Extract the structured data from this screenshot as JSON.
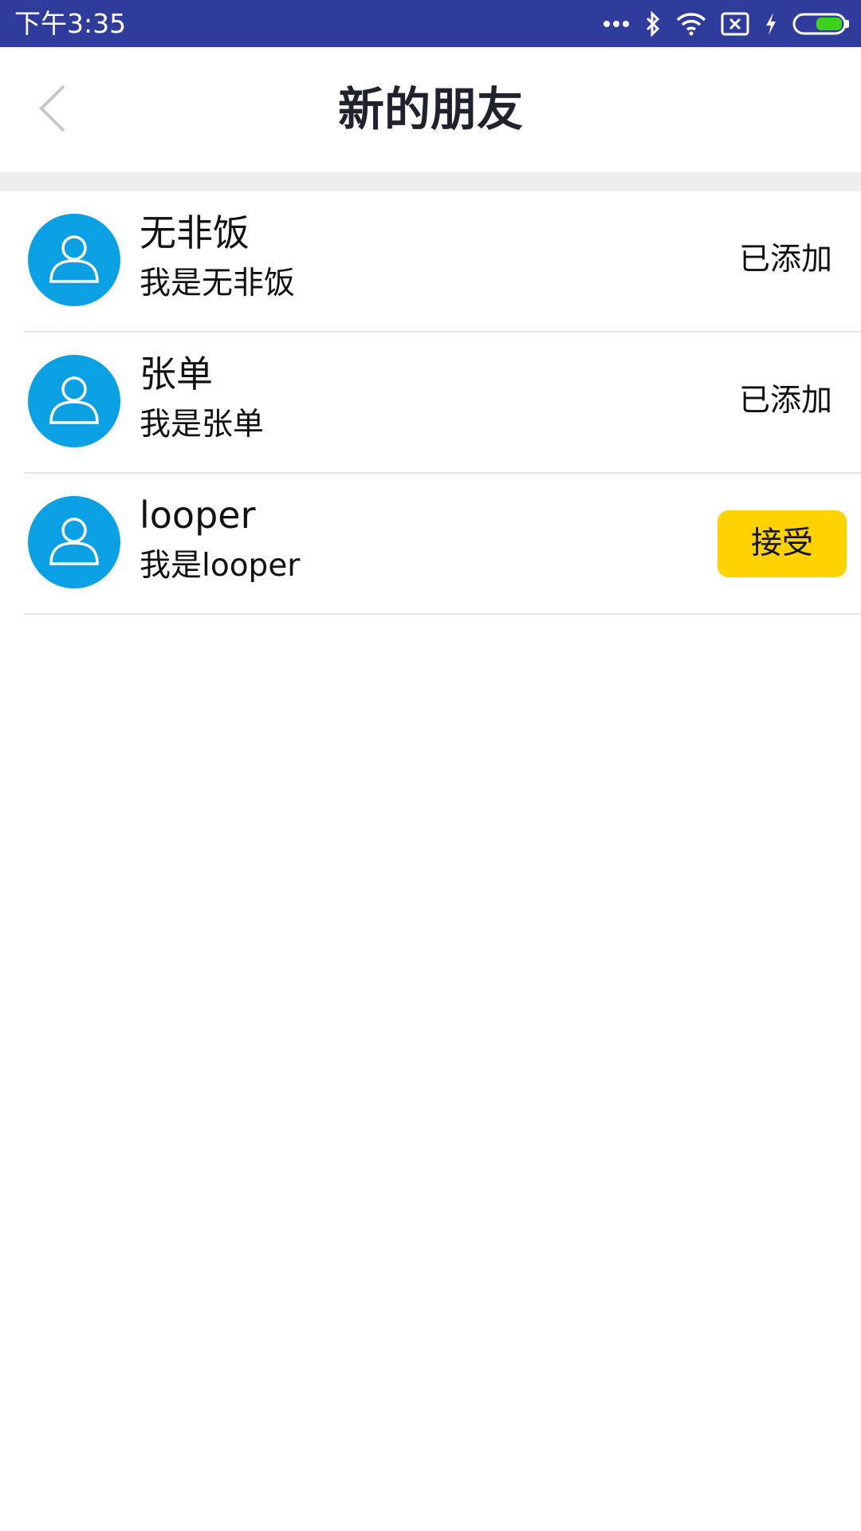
{
  "status_bar": {
    "time": "下午3:35",
    "icons": [
      "more-dots-icon",
      "bluetooth-icon",
      "wifi-icon",
      "no-sim-icon",
      "charging-icon",
      "battery-icon"
    ],
    "background": "#303c9b"
  },
  "header": {
    "title": "新的朋友",
    "back_icon": "chevron-left-icon"
  },
  "friends": [
    {
      "name": "无非饭",
      "message": "我是无非饭",
      "status": "已添加",
      "state": "added"
    },
    {
      "name": "张单",
      "message": "我是张单",
      "status": "已添加",
      "state": "added"
    },
    {
      "name": "looper",
      "message": "我是looper",
      "action": "接受",
      "state": "pending"
    }
  ],
  "colors": {
    "avatar": "#0aa0e3",
    "accept_button": "#ffd200",
    "battery_fill": "#3ecf1f"
  }
}
